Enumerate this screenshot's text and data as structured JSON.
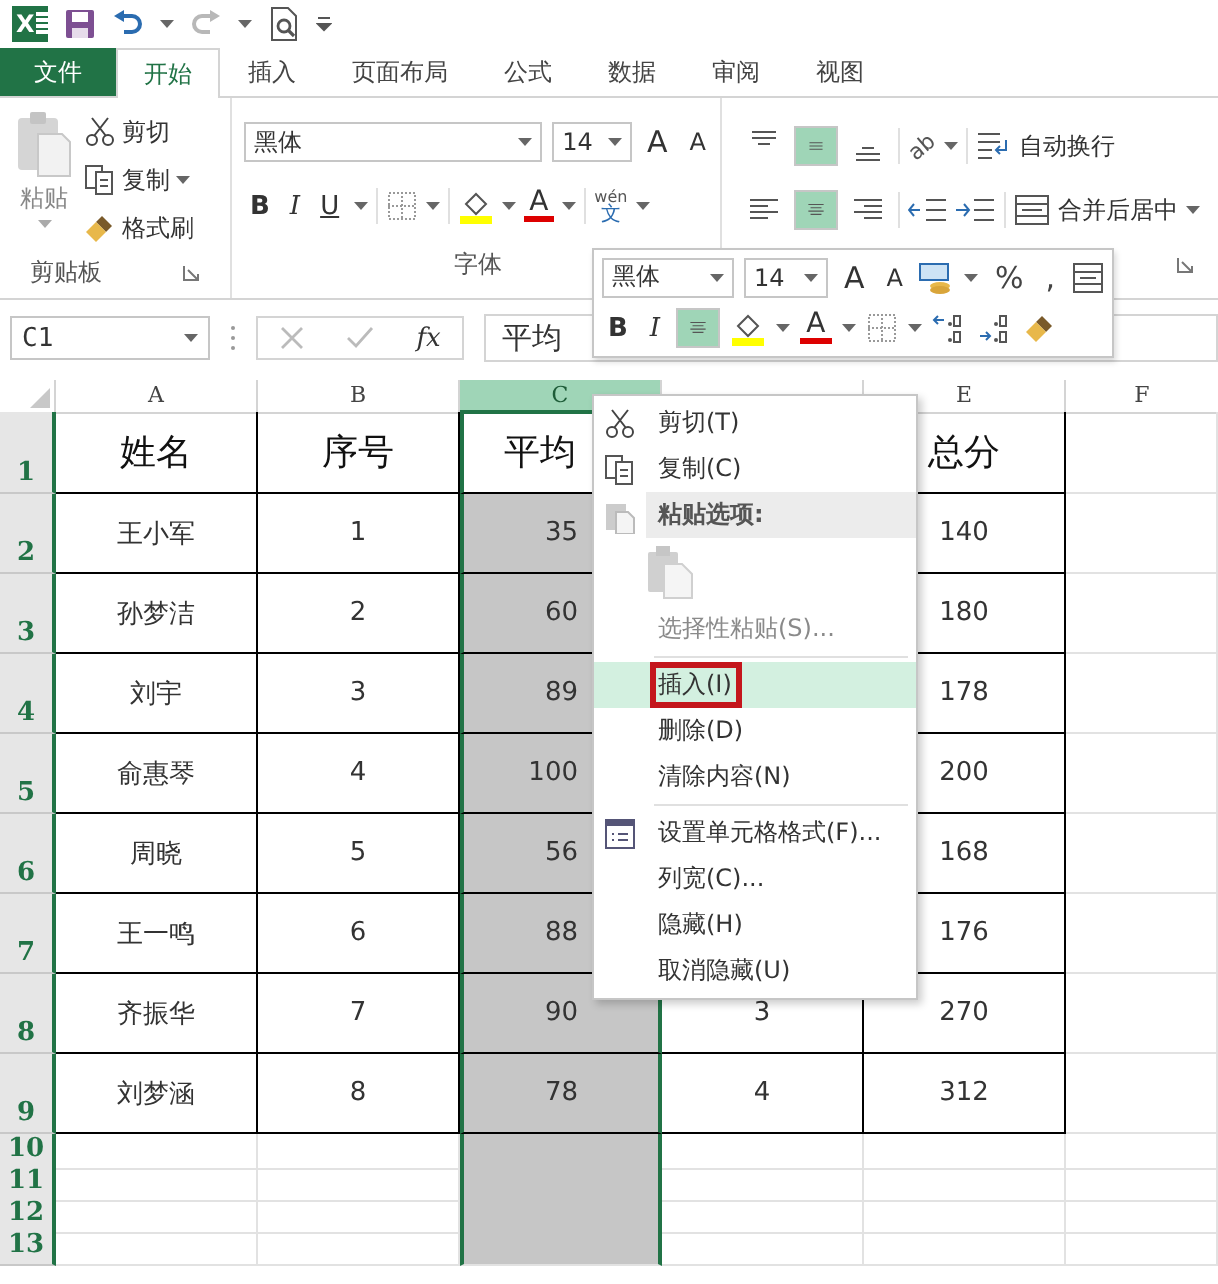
{
  "app_logo": "X",
  "tabs": [
    {
      "label": "文件",
      "kind": "file",
      "selected": false
    },
    {
      "label": "开始",
      "kind": "tab",
      "selected": true
    },
    {
      "label": "插入",
      "kind": "tab",
      "selected": false
    },
    {
      "label": "页面布局",
      "kind": "tab",
      "selected": false
    },
    {
      "label": "公式",
      "kind": "tab",
      "selected": false
    },
    {
      "label": "数据",
      "kind": "tab",
      "selected": false
    },
    {
      "label": "审阅",
      "kind": "tab",
      "selected": false
    },
    {
      "label": "视图",
      "kind": "tab",
      "selected": false
    }
  ],
  "ribbon": {
    "clipboard": {
      "paste": "粘贴",
      "cut": "剪切",
      "copy": "复制",
      "format_painter": "格式刷",
      "label": "剪贴板"
    },
    "font": {
      "font_name": "黑体",
      "font_size": "14",
      "grow": "A",
      "shrink": "A",
      "bold": "B",
      "italic": "I",
      "underline": "U",
      "font_color": "A",
      "phonetic_top": "wén",
      "phonetic_bottom": "文",
      "label": "字体"
    },
    "alignment": {
      "vertical": [
        {
          "selected": false
        },
        {
          "selected": true
        },
        {
          "selected": false
        }
      ],
      "horizontal": [
        {
          "selected": false
        },
        {
          "selected": true
        },
        {
          "selected": false
        }
      ],
      "orientation": "ab",
      "wrap_text": "自动换行",
      "merge_center": "合并后居中"
    }
  },
  "name_box": "C1",
  "fx": "fx",
  "formula": "平均",
  "mini_toolbar": {
    "font_name": "黑体",
    "font_size": "14",
    "grow": "A",
    "shrink": "A",
    "percent": "%",
    "comma": ",",
    "bold": "B",
    "italic": "I",
    "center_selected": true,
    "font_color": "A"
  },
  "sheet": {
    "columns": [
      {
        "label": "A",
        "selected": false
      },
      {
        "label": "B",
        "selected": false
      },
      {
        "label": "C",
        "selected": true
      },
      {
        "selected": false
      },
      {
        "label": "E",
        "selected": false
      },
      {
        "label": "F",
        "selected": false
      }
    ],
    "rows": [
      {
        "header": "1",
        "kind": "heading",
        "a": "姓名",
        "b": "序号",
        "c": "平均",
        "e": "总分"
      },
      {
        "header": "2",
        "kind": "data",
        "a": "王小军",
        "b": "1",
        "c": "35",
        "e": "140"
      },
      {
        "header": "3",
        "kind": "data",
        "a": "孙梦洁",
        "b": "2",
        "c": "60",
        "e": "180"
      },
      {
        "header": "4",
        "kind": "data",
        "a": "刘宇",
        "b": "3",
        "c": "89",
        "e": "178"
      },
      {
        "header": "5",
        "kind": "data",
        "a": "俞惠琴",
        "b": "4",
        "c": "100",
        "e": "200"
      },
      {
        "header": "6",
        "kind": "data",
        "a": "周晓",
        "b": "5",
        "c": "56",
        "e": "168"
      },
      {
        "header": "7",
        "kind": "data",
        "a": "王一鸣",
        "b": "6",
        "c": "88",
        "e": "176"
      },
      {
        "header": "8",
        "kind": "data",
        "a": "齐振华",
        "b": "7",
        "c": "90",
        "d": "3",
        "e": "270"
      },
      {
        "header": "9",
        "kind": "data",
        "a": "刘梦涵",
        "b": "8",
        "c": "78",
        "d": "4",
        "e": "312"
      },
      {
        "header": "10",
        "kind": "blank"
      },
      {
        "header": "11",
        "kind": "blank"
      },
      {
        "header": "12",
        "kind": "blank"
      },
      {
        "header": "13",
        "kind": "blank"
      }
    ]
  },
  "context_menu": {
    "items": [
      {
        "kind": "cut",
        "label": "剪切(T)",
        "disabled": false,
        "selected": false,
        "outlined": false
      },
      {
        "kind": "copy",
        "label": "复制(C)",
        "disabled": false,
        "selected": false,
        "outlined": false
      },
      {
        "kind": "heading",
        "label": "粘贴选项:"
      },
      {
        "kind": "paste-option",
        "disabled": true
      },
      {
        "kind": "item",
        "label": "选择性粘贴(S)...",
        "disabled": true,
        "selected": false,
        "outlined": false
      },
      {
        "kind": "separator"
      },
      {
        "kind": "item",
        "label": "插入(I)",
        "disabled": false,
        "selected": true,
        "outlined": true
      },
      {
        "kind": "item",
        "label": "删除(D)",
        "disabled": false,
        "selected": false,
        "outlined": false
      },
      {
        "kind": "item",
        "label": "清除内容(N)",
        "disabled": false,
        "selected": false,
        "outlined": false
      },
      {
        "kind": "separator"
      },
      {
        "kind": "format",
        "label": "设置单元格格式(F)...",
        "disabled": false,
        "selected": false,
        "outlined": false
      },
      {
        "kind": "item",
        "label": "列宽(C)...",
        "disabled": false,
        "selected": false,
        "outlined": false
      },
      {
        "kind": "item",
        "label": "隐藏(H)",
        "disabled": false,
        "selected": false,
        "outlined": false
      },
      {
        "kind": "item",
        "label": "取消隐藏(U)",
        "disabled": false,
        "selected": false,
        "outlined": false
      }
    ]
  }
}
